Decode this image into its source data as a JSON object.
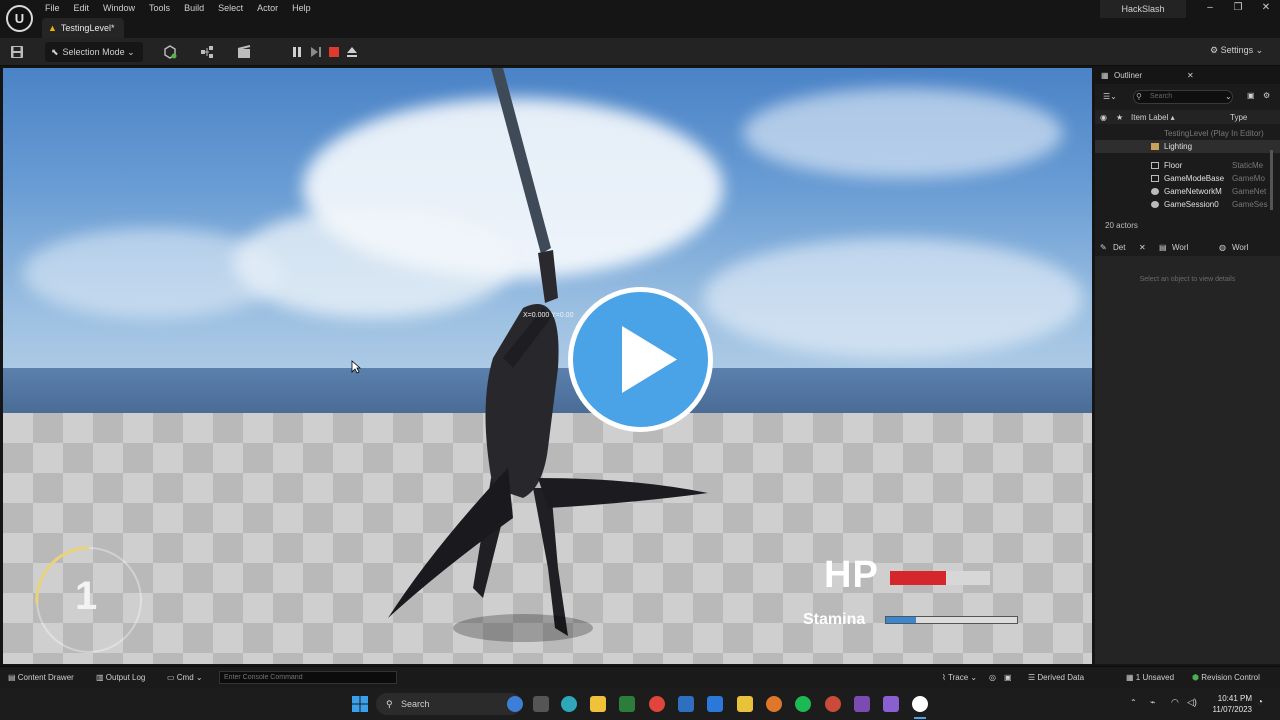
{
  "app": {
    "menu": [
      "File",
      "Edit",
      "Window",
      "Tools",
      "Build",
      "Select",
      "Actor",
      "Help"
    ],
    "level_tab": "TestingLevel*",
    "project_name": "HackSlash"
  },
  "toolbar": {
    "selection_mode": "Selection Mode",
    "settings": "Settings"
  },
  "viewport": {
    "coords": "X=0.000 Y=0.00",
    "hud": {
      "combo_count": "1",
      "hp_label": "HP",
      "hp_fraction": 0.56,
      "stamina_label": "Stamina",
      "stamina_fraction": 0.23,
      "hp_color": "#d5272b",
      "stamina_color": "#3a86d0"
    }
  },
  "outliner": {
    "title": "Outliner",
    "search_placeholder": "Search",
    "col_label": "Item Label ▴",
    "col_type": "Type",
    "rows": [
      {
        "label": "TestingLevel (Play In Editor)",
        "type": "",
        "icon": "level-icon"
      },
      {
        "label": "Lighting",
        "type": "",
        "icon": "folder-icon"
      },
      {
        "label": "Floor",
        "type": "StaticMe",
        "icon": "mesh-icon"
      },
      {
        "label": "GameModeBase",
        "type": "GameMo",
        "icon": "actor-icon"
      },
      {
        "label": "GameNetworkM",
        "type": "GameNet",
        "icon": "actor-icon"
      },
      {
        "label": "GameSession0",
        "type": "GameSes",
        "icon": "actor-icon"
      }
    ],
    "actor_count": "20 actors"
  },
  "details": {
    "tabs": [
      "Det",
      "Worl",
      "Worl"
    ],
    "hint": "Select an object to view details"
  },
  "statusbar": {
    "content_drawer": "Content Drawer",
    "output_log": "Output Log",
    "cmd": "Cmd",
    "console_placeholder": "Enter Console Command",
    "trace": "Trace",
    "derived_data": "Derived Data",
    "unsaved": "1 Unsaved",
    "revision_control": "Revision Control"
  },
  "taskbar": {
    "search": "Search",
    "time": "10:41 PM",
    "date": "11/07/2023",
    "accent": "#4aa3e6"
  }
}
